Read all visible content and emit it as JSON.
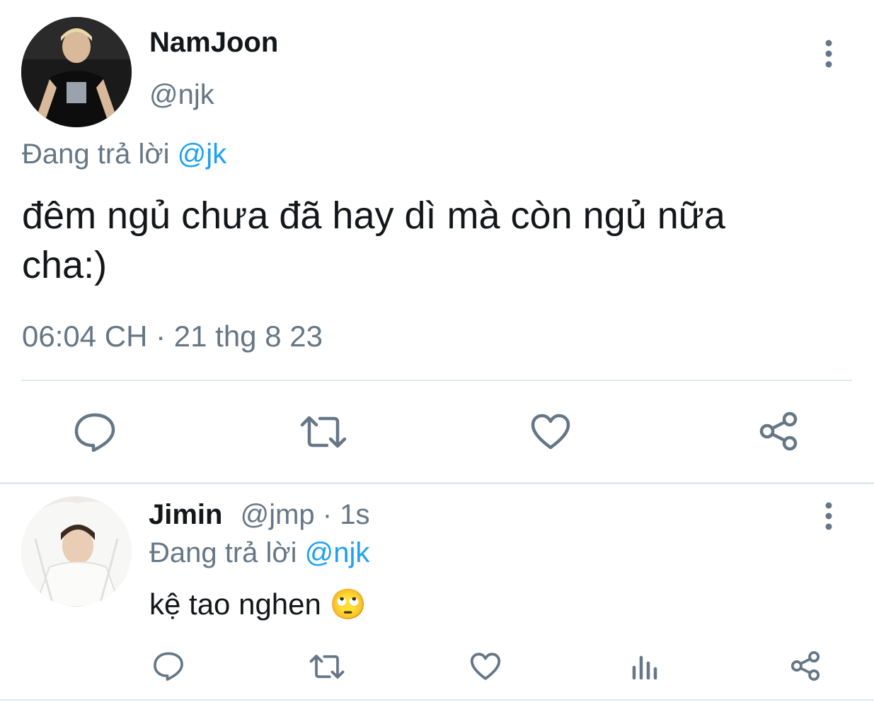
{
  "main_tweet": {
    "author_name": "NamJoon",
    "author_handle": "@njk",
    "replying_prefix": "Đang trả lời",
    "replying_handle": "@jk",
    "text_line1": "đêm ngủ chưa đã hay dì mà còn ngủ nữa",
    "text_line2": "cha:)",
    "timestamp": "06:04 CH · 21 thg 8 23"
  },
  "reply_tweet": {
    "author_name": "Jimin",
    "author_handle": "@jmp",
    "time_ago": "· 1s",
    "replying_prefix": "Đang trả lời",
    "replying_handle": "@njk",
    "text": "kệ tao nghen",
    "emoji": "🙄"
  },
  "colors": {
    "accent": "#1da1f2",
    "muted": "#657786",
    "icon": "#657786",
    "divider": "#e1e8ed"
  },
  "icons": [
    "more-vert-icon",
    "reply-icon",
    "retweet-icon",
    "like-icon",
    "share-icon",
    "analytics-icon"
  ]
}
